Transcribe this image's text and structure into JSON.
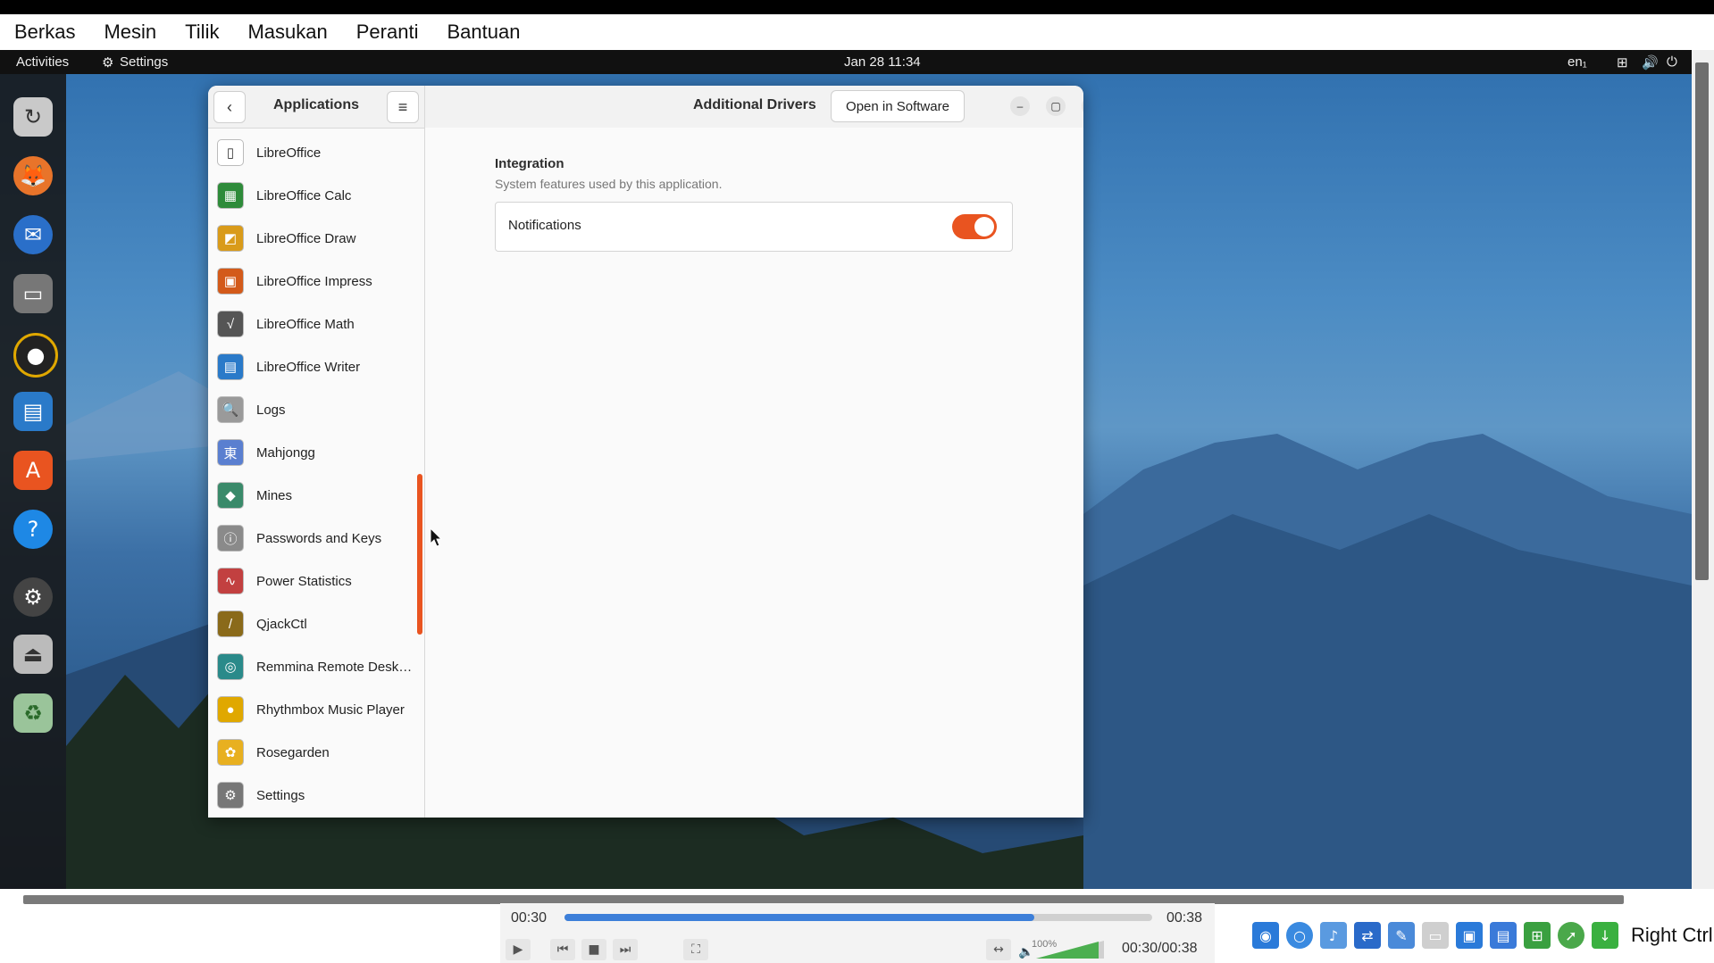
{
  "host_menu": [
    "Berkas",
    "Mesin",
    "Tilik",
    "Masukan",
    "Peranti",
    "Bantuan"
  ],
  "topbar": {
    "activities": "Activities",
    "app_name": "Settings",
    "datetime": "Jan 28  11:34",
    "input_method": "en₁"
  },
  "sidebar": {
    "title": "Applications",
    "apps": [
      {
        "label": "LibreOffice",
        "icon": "libreoffice-icon",
        "color": "#ffffff"
      },
      {
        "label": "LibreOffice Calc",
        "icon": "libreoffice-calc-icon",
        "color": "#2e8b3a"
      },
      {
        "label": "LibreOffice Draw",
        "icon": "libreoffice-draw-icon",
        "color": "#d99b1a"
      },
      {
        "label": "LibreOffice Impress",
        "icon": "libreoffice-impress-icon",
        "color": "#d35a1a"
      },
      {
        "label": "LibreOffice Math",
        "icon": "libreoffice-math-icon",
        "color": "#555555"
      },
      {
        "label": "LibreOffice Writer",
        "icon": "libreoffice-writer-icon",
        "color": "#2a7ac9"
      },
      {
        "label": "Logs",
        "icon": "logs-icon",
        "color": "#9a9a9a"
      },
      {
        "label": "Mahjongg",
        "icon": "mahjongg-icon",
        "color": "#5a7fd0"
      },
      {
        "label": "Mines",
        "icon": "mines-icon",
        "color": "#3a8a6a"
      },
      {
        "label": "Passwords and Keys",
        "icon": "passwords-icon",
        "color": "#8a8a8a"
      },
      {
        "label": "Power Statistics",
        "icon": "power-statistics-icon",
        "color": "#c24040"
      },
      {
        "label": "QjackCtl",
        "icon": "qjackctl-icon",
        "color": "#8a6a1a"
      },
      {
        "label": "Remmina Remote Desktop Client",
        "icon": "remmina-icon",
        "color": "#2a8a8a"
      },
      {
        "label": "Rhythmbox Music Player",
        "icon": "rhythmbox-icon",
        "color": "#e0a800"
      },
      {
        "label": "Rosegarden",
        "icon": "rosegarden-icon",
        "color": "#e8b020"
      },
      {
        "label": "Settings",
        "icon": "settings-icon",
        "color": "#777777"
      }
    ]
  },
  "main": {
    "title": "Additional Drivers",
    "open_button": "Open in Software",
    "section_title": "Integration",
    "section_subtitle": "System features used by this application.",
    "notifications_label": "Notifications",
    "notifications_enabled": true
  },
  "media": {
    "elapsed": "00:30",
    "duration": "00:38",
    "progress": 0.8,
    "volume": "100%",
    "time_combined": "00:30/00:38",
    "host_key": "Right Ctrl"
  },
  "colors": {
    "accent": "#e95420",
    "progress": "#3d7fd9"
  }
}
